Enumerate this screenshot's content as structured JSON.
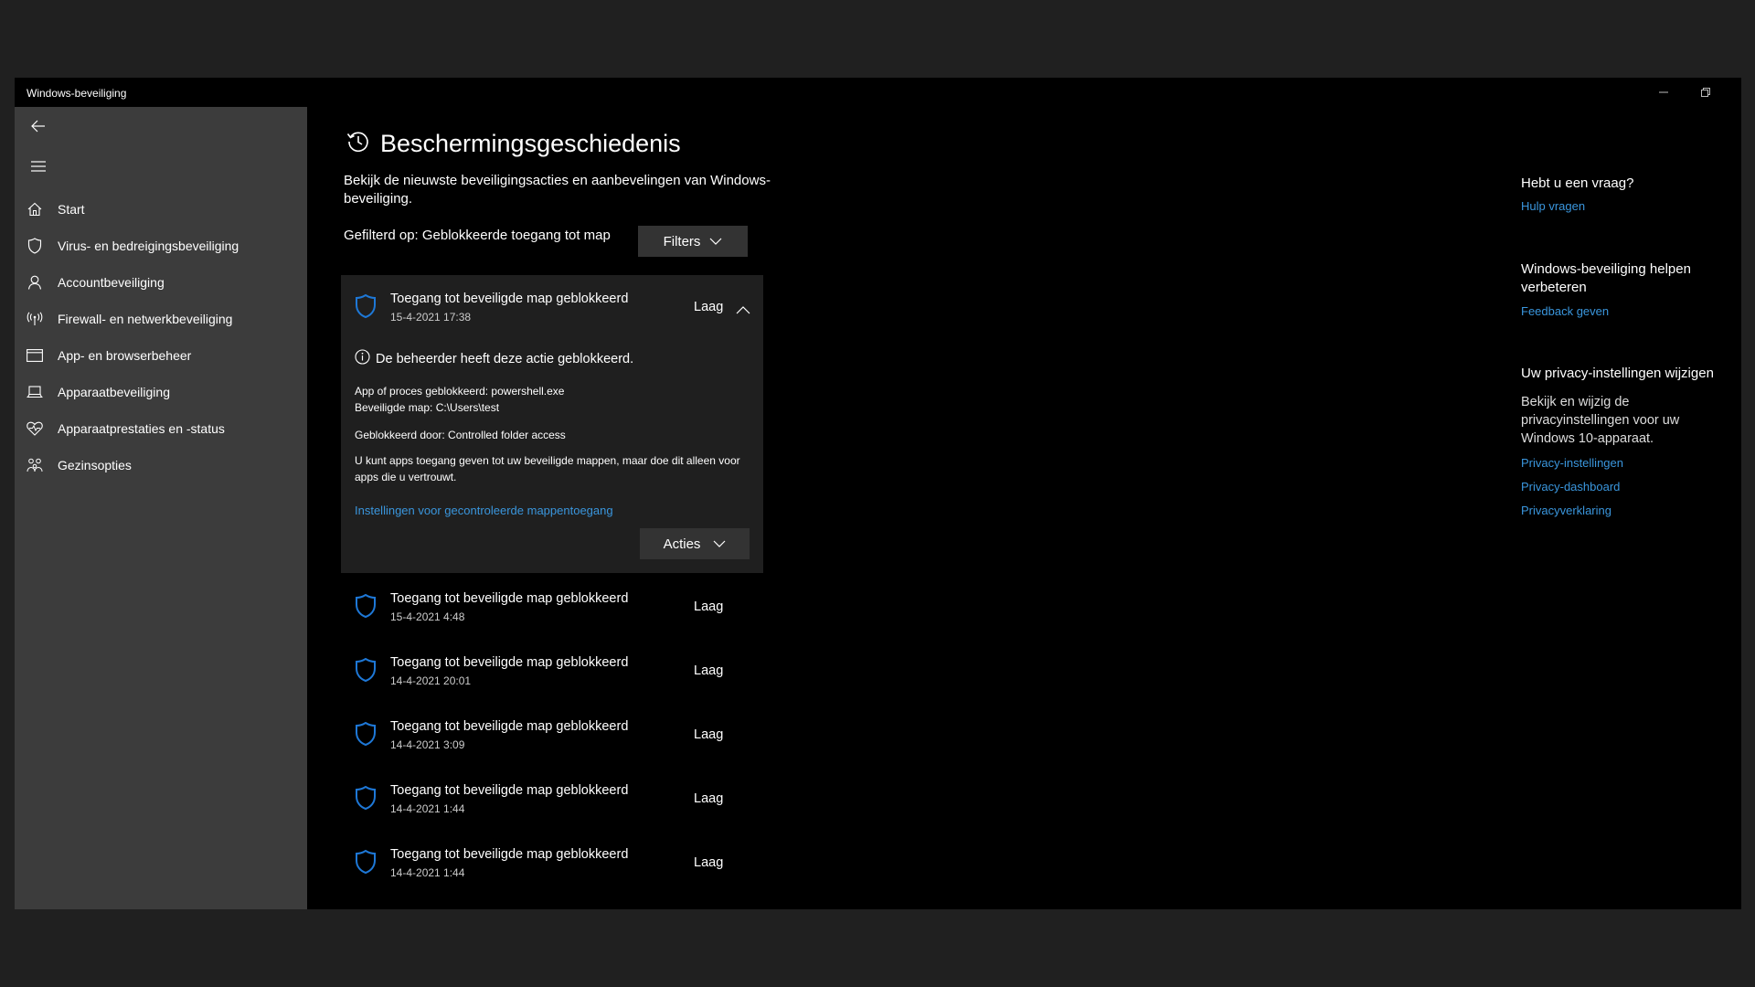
{
  "window": {
    "title": "Windows-beveiliging",
    "controls": [
      "minimize-icon",
      "restore-icon"
    ]
  },
  "sidebar": {
    "items": [
      {
        "label": "Start",
        "icon": "home-icon"
      },
      {
        "label": "Virus- en bedreigingsbeveiliging",
        "icon": "shield-icon"
      },
      {
        "label": "Accountbeveiliging",
        "icon": "person-icon"
      },
      {
        "label": "Firewall- en netwerkbeveiliging",
        "icon": "antenna-icon"
      },
      {
        "label": "App- en browserbeheer",
        "icon": "browser-window-icon"
      },
      {
        "label": "Apparaatbeveiliging",
        "icon": "laptop-icon"
      },
      {
        "label": "Apparaatprestaties en -status",
        "icon": "heart-pulse-icon"
      },
      {
        "label": "Gezinsopties",
        "icon": "family-icon"
      }
    ]
  },
  "page": {
    "title": "Beschermingsgeschiedenis",
    "subtitle": "Bekijk de nieuwste beveiligingsacties en aanbevelingen van Windows-beveiliging.",
    "filtered_label": "Gefilterd op: Geblokkeerde toegang tot map",
    "filters_button": "Filters"
  },
  "expanded": {
    "title": "Toegang tot beveiligde map geblokkeerd",
    "date": "15-4-2021 17:38",
    "severity": "Laag",
    "admin_note": "De beheerder heeft deze actie geblokkeerd.",
    "app_line": "App of proces geblokkeerd: powershell.exe",
    "folder_line": "Beveiligde map: C:\\Users\\test",
    "blocked_by_line": "Geblokkeerd door: Controlled folder access",
    "info_text": "U kunt apps toegang geven tot uw beveiligde mappen, maar doe dit alleen voor apps die u vertrouwt.",
    "settings_link": "Instellingen voor gecontroleerde mappentoegang",
    "actions_button": "Acties"
  },
  "items": [
    {
      "title": "Toegang tot beveiligde map geblokkeerd",
      "date": "15-4-2021 4:48",
      "severity": "Laag"
    },
    {
      "title": "Toegang tot beveiligde map geblokkeerd",
      "date": "14-4-2021 20:01",
      "severity": "Laag"
    },
    {
      "title": "Toegang tot beveiligde map geblokkeerd",
      "date": "14-4-2021 3:09",
      "severity": "Laag"
    },
    {
      "title": "Toegang tot beveiligde map geblokkeerd",
      "date": "14-4-2021 1:44",
      "severity": "Laag"
    },
    {
      "title": "Toegang tot beveiligde map geblokkeerd",
      "date": "14-4-2021 1:44",
      "severity": "Laag"
    }
  ],
  "right_panel": {
    "question_heading": "Hebt u een vraag?",
    "help_link": "Hulp vragen",
    "improve_heading": "Windows-beveiliging helpen verbeteren",
    "feedback_link": "Feedback geven",
    "privacy_heading": "Uw privacy-instellingen wijzigen",
    "privacy_text": "Bekijk en wijzig de privacyinstellingen voor uw Windows 10-apparaat.",
    "privacy_settings_link": "Privacy-instellingen",
    "privacy_dashboard_link": "Privacy-dashboard",
    "privacy_statement_link": "Privacyverklaring"
  },
  "colors": {
    "accent_link": "#3a96dd",
    "shield_blue": "#1e78d7",
    "sidebar_bg": "#3c3c3c",
    "window_bg": "#000000"
  }
}
